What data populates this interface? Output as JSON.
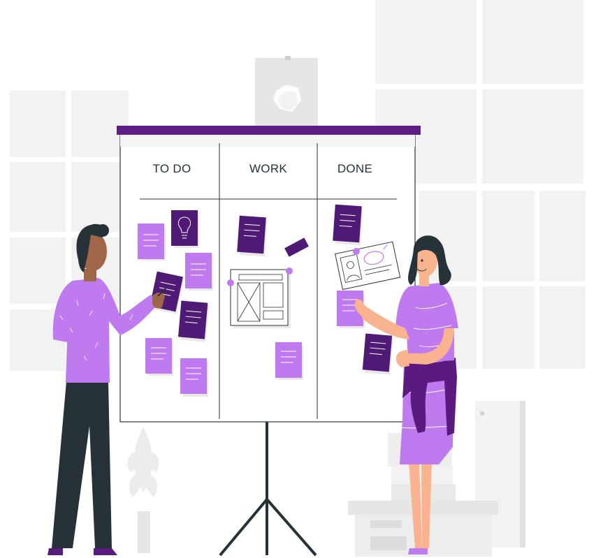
{
  "board": {
    "columns": [
      {
        "label": "TO DO"
      },
      {
        "label": "WORK"
      },
      {
        "label": "DONE"
      }
    ]
  },
  "colors": {
    "accent": "#5a1a7f",
    "note_light": "#bf7af0",
    "note_dark": "#4f1a76",
    "board_bar": "#5e1d86",
    "skin_man": "#a0664a",
    "skin_woman": "#f9b38f",
    "hair": "#263238",
    "pants": "#263238",
    "background_panel": "#f2f2f2"
  }
}
